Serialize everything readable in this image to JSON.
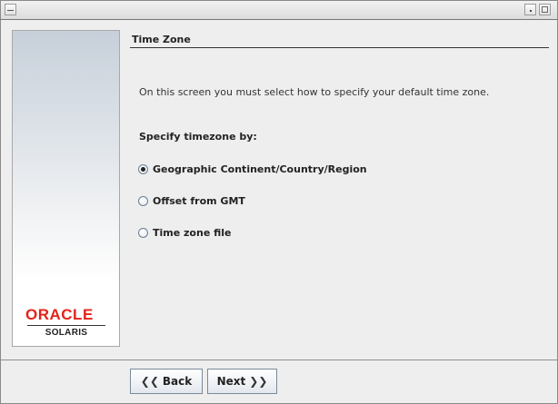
{
  "window": {
    "menu_icon": "window-menu-icon",
    "minimize_icon": "minimize-icon",
    "maximize_icon": "maximize-icon"
  },
  "branding": {
    "logo_text": "ORACLE",
    "product": "SOLARIS",
    "logo_color": "#e2231a"
  },
  "page": {
    "title": "Time Zone",
    "intro": "On this screen you must select how to specify your default time zone.",
    "specify_label": "Specify timezone by:"
  },
  "options": [
    {
      "label": "Geographic Continent/Country/Region",
      "selected": true
    },
    {
      "label": "Offset from GMT",
      "selected": false
    },
    {
      "label": "Time zone file",
      "selected": false
    }
  ],
  "nav": {
    "back_label": "Back",
    "next_label": "Next",
    "back_icon": "double-chevron-left-icon",
    "next_icon": "double-chevron-right-icon"
  }
}
